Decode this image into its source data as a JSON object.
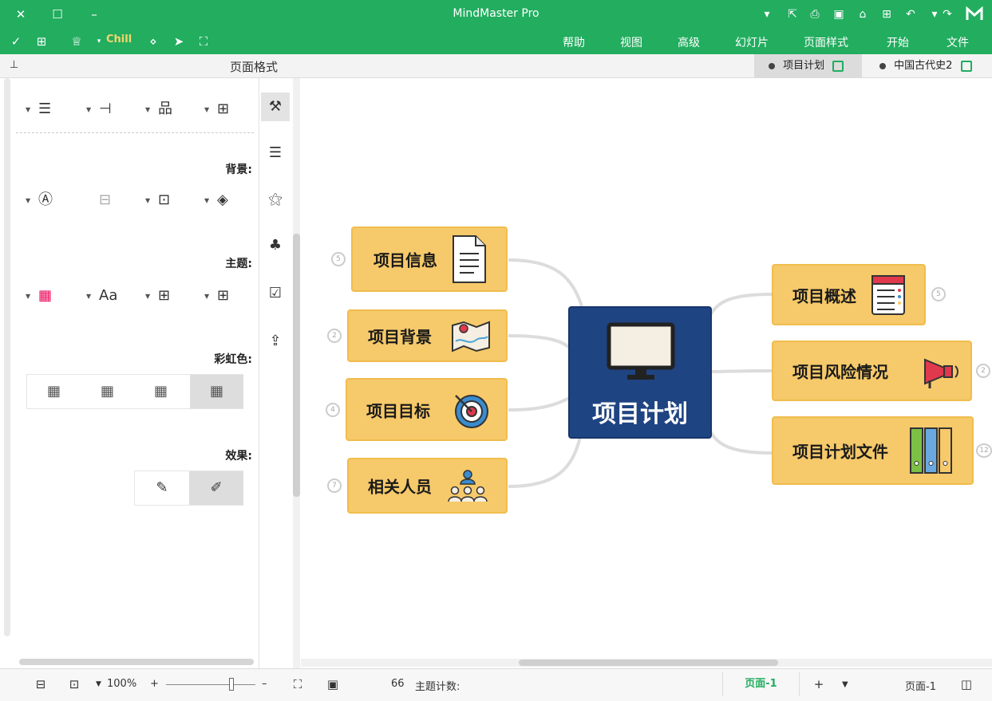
{
  "titlebar": {
    "title": "MindMaster Pro",
    "close_icon": "✕",
    "maximize_icon": "☐",
    "minimize_icon": "–"
  },
  "menu": {
    "items": [
      "帮助",
      "视图",
      "高级",
      "幻灯片",
      "页面样式",
      "开始",
      "文件"
    ],
    "theme_label": "Chill"
  },
  "tabs": {
    "panel_title": "页面格式",
    "docs": [
      {
        "label": "项目计划",
        "active": true
      },
      {
        "label": "中国古代史2",
        "active": false
      }
    ]
  },
  "panel": {
    "sections": {
      "background": "背景:",
      "theme": "主题:",
      "rainbow": "彩虹色:",
      "effect": "效果:"
    }
  },
  "mindmap": {
    "central": "项目计划",
    "left_nodes": [
      {
        "label": "项目信息",
        "badge": "5"
      },
      {
        "label": "项目背景",
        "badge": "2"
      },
      {
        "label": "项目目标",
        "badge": "4"
      },
      {
        "label": "相关人员",
        "badge": "7"
      }
    ],
    "right_nodes": [
      {
        "label": "项目概述",
        "badge": "5"
      },
      {
        "label": "项目风险情况",
        "badge": "2"
      },
      {
        "label": "项目计划文件",
        "badge": "12"
      }
    ],
    "colors": {
      "node_fill": "#f6c96a",
      "central_fill": "#1f4482",
      "brand": "#22ad5f"
    }
  },
  "status": {
    "zoom": "100%",
    "topic_count_label": "主题计数:",
    "topic_count_value": "66",
    "page_tab": "页面-1",
    "page_selector": "页面-1"
  }
}
